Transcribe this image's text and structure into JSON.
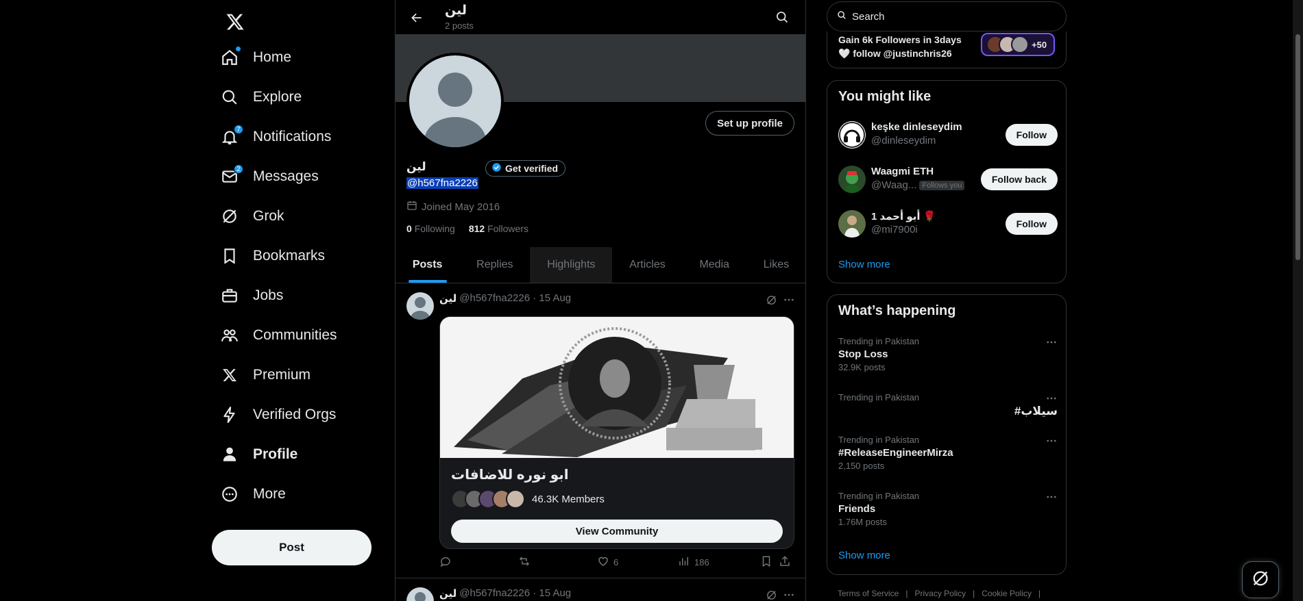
{
  "nav": {
    "items": [
      {
        "label": "Home",
        "icon": "home-icon",
        "badge": "",
        "dot": true
      },
      {
        "label": "Explore",
        "icon": "search-icon",
        "badge": ""
      },
      {
        "label": "Notifications",
        "icon": "bell-icon",
        "badge": "7"
      },
      {
        "label": "Messages",
        "icon": "envelope-icon",
        "badge": "2"
      },
      {
        "label": "Grok",
        "icon": "grok-icon",
        "badge": ""
      },
      {
        "label": "Bookmarks",
        "icon": "bookmark-icon",
        "badge": ""
      },
      {
        "label": "Jobs",
        "icon": "briefcase-icon",
        "badge": ""
      },
      {
        "label": "Communities",
        "icon": "people-icon",
        "badge": ""
      },
      {
        "label": "Premium",
        "icon": "x-logo-icon",
        "badge": ""
      },
      {
        "label": "Verified Orgs",
        "icon": "lightning-icon",
        "badge": ""
      },
      {
        "label": "Profile",
        "icon": "person-icon",
        "badge": "",
        "active": true
      },
      {
        "label": "More",
        "icon": "more-circle-icon",
        "badge": ""
      }
    ],
    "post_label": "Post"
  },
  "header": {
    "name": "لين",
    "posts_count": "2 posts"
  },
  "profile": {
    "name": "لين",
    "handle": "@h567fna2226",
    "verify_label": "Get verified",
    "setup_label": "Set up profile",
    "joined": "Joined May 2016",
    "following_count": "0",
    "following_label": "Following",
    "followers_count": "812",
    "followers_label": "Followers"
  },
  "tabs": [
    "Posts",
    "Replies",
    "Highlights",
    "Articles",
    "Media",
    "Likes"
  ],
  "tweet": {
    "name": "لين",
    "meta": "@h567fna2226 · 15 Aug",
    "community_title": "ابو نوره للاضافات",
    "members": "46.3K Members",
    "view_label": "View Community",
    "likes": "6",
    "views": "186"
  },
  "tweet2": {
    "name": "لين",
    "meta": "@h567fna2226 · 15 Aug"
  },
  "right": {
    "search_placeholder": "Search",
    "promo_line1": "Gain 6k Followers in 3days",
    "promo_line2": "🤍 follow @justinchris26",
    "promo_count": "+50",
    "wtf_title": "You might like",
    "wtf": [
      {
        "name": "keşke dinleseydim",
        "handle": "@dinleseydim",
        "button": "Follow",
        "follows_you": ""
      },
      {
        "name": "Waagmi ETH",
        "handle": "@Waag...",
        "button": "Follow back",
        "follows_you": "Follows you"
      },
      {
        "name": "أبو أحمد 1 🌹",
        "handle": "@mi7900i",
        "button": "Follow",
        "follows_you": ""
      }
    ],
    "show_more": "Show more",
    "trends_title": "What’s happening",
    "trends": [
      {
        "context": "Trending in Pakistan",
        "title": "Stop Loss",
        "count": "32.9K posts"
      },
      {
        "context": "Trending in Pakistan",
        "title": "#سیلاب",
        "count": ""
      },
      {
        "context": "Trending in Pakistan",
        "title": "#ReleaseEngineerMirza",
        "count": "2,150 posts"
      },
      {
        "context": "Trending in Pakistan",
        "title": "Friends",
        "count": "1.76M posts"
      }
    ],
    "footer": [
      "Terms of Service",
      "|",
      "Privacy Policy",
      "|",
      "Cookie Policy",
      "|"
    ]
  },
  "colors": {
    "accent": "#1d9bf0",
    "background": "#000000",
    "border": "#2f3336",
    "muted": "#71767b"
  }
}
